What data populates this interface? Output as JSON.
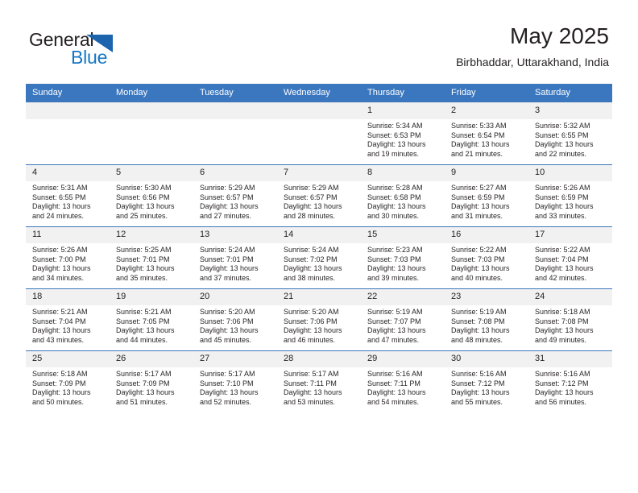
{
  "logo": {
    "word1": "General",
    "word2": "Blue",
    "triangle_color": "#1c64ae",
    "blue_text_color": "#1476c6"
  },
  "header": {
    "title": "May 2025",
    "subtitle": "Birbhaddar, Uttarakhand, India"
  },
  "theme": {
    "accent": "#3b77bf",
    "daynum_bg": "#f1f1f1",
    "text": "#231f20"
  },
  "calendar": {
    "weekday_headers": [
      "Sunday",
      "Monday",
      "Tuesday",
      "Wednesday",
      "Thursday",
      "Friday",
      "Saturday"
    ],
    "weeks": [
      [
        {
          "day": "",
          "lines": []
        },
        {
          "day": "",
          "lines": []
        },
        {
          "day": "",
          "lines": []
        },
        {
          "day": "",
          "lines": []
        },
        {
          "day": "1",
          "lines": [
            "Sunrise: 5:34 AM",
            "Sunset: 6:53 PM",
            "Daylight: 13 hours and 19 minutes."
          ]
        },
        {
          "day": "2",
          "lines": [
            "Sunrise: 5:33 AM",
            "Sunset: 6:54 PM",
            "Daylight: 13 hours and 21 minutes."
          ]
        },
        {
          "day": "3",
          "lines": [
            "Sunrise: 5:32 AM",
            "Sunset: 6:55 PM",
            "Daylight: 13 hours and 22 minutes."
          ]
        }
      ],
      [
        {
          "day": "4",
          "lines": [
            "Sunrise: 5:31 AM",
            "Sunset: 6:55 PM",
            "Daylight: 13 hours and 24 minutes."
          ]
        },
        {
          "day": "5",
          "lines": [
            "Sunrise: 5:30 AM",
            "Sunset: 6:56 PM",
            "Daylight: 13 hours and 25 minutes."
          ]
        },
        {
          "day": "6",
          "lines": [
            "Sunrise: 5:29 AM",
            "Sunset: 6:57 PM",
            "Daylight: 13 hours and 27 minutes."
          ]
        },
        {
          "day": "7",
          "lines": [
            "Sunrise: 5:29 AM",
            "Sunset: 6:57 PM",
            "Daylight: 13 hours and 28 minutes."
          ]
        },
        {
          "day": "8",
          "lines": [
            "Sunrise: 5:28 AM",
            "Sunset: 6:58 PM",
            "Daylight: 13 hours and 30 minutes."
          ]
        },
        {
          "day": "9",
          "lines": [
            "Sunrise: 5:27 AM",
            "Sunset: 6:59 PM",
            "Daylight: 13 hours and 31 minutes."
          ]
        },
        {
          "day": "10",
          "lines": [
            "Sunrise: 5:26 AM",
            "Sunset: 6:59 PM",
            "Daylight: 13 hours and 33 minutes."
          ]
        }
      ],
      [
        {
          "day": "11",
          "lines": [
            "Sunrise: 5:26 AM",
            "Sunset: 7:00 PM",
            "Daylight: 13 hours and 34 minutes."
          ]
        },
        {
          "day": "12",
          "lines": [
            "Sunrise: 5:25 AM",
            "Sunset: 7:01 PM",
            "Daylight: 13 hours and 35 minutes."
          ]
        },
        {
          "day": "13",
          "lines": [
            "Sunrise: 5:24 AM",
            "Sunset: 7:01 PM",
            "Daylight: 13 hours and 37 minutes."
          ]
        },
        {
          "day": "14",
          "lines": [
            "Sunrise: 5:24 AM",
            "Sunset: 7:02 PM",
            "Daylight: 13 hours and 38 minutes."
          ]
        },
        {
          "day": "15",
          "lines": [
            "Sunrise: 5:23 AM",
            "Sunset: 7:03 PM",
            "Daylight: 13 hours and 39 minutes."
          ]
        },
        {
          "day": "16",
          "lines": [
            "Sunrise: 5:22 AM",
            "Sunset: 7:03 PM",
            "Daylight: 13 hours and 40 minutes."
          ]
        },
        {
          "day": "17",
          "lines": [
            "Sunrise: 5:22 AM",
            "Sunset: 7:04 PM",
            "Daylight: 13 hours and 42 minutes."
          ]
        }
      ],
      [
        {
          "day": "18",
          "lines": [
            "Sunrise: 5:21 AM",
            "Sunset: 7:04 PM",
            "Daylight: 13 hours and 43 minutes."
          ]
        },
        {
          "day": "19",
          "lines": [
            "Sunrise: 5:21 AM",
            "Sunset: 7:05 PM",
            "Daylight: 13 hours and 44 minutes."
          ]
        },
        {
          "day": "20",
          "lines": [
            "Sunrise: 5:20 AM",
            "Sunset: 7:06 PM",
            "Daylight: 13 hours and 45 minutes."
          ]
        },
        {
          "day": "21",
          "lines": [
            "Sunrise: 5:20 AM",
            "Sunset: 7:06 PM",
            "Daylight: 13 hours and 46 minutes."
          ]
        },
        {
          "day": "22",
          "lines": [
            "Sunrise: 5:19 AM",
            "Sunset: 7:07 PM",
            "Daylight: 13 hours and 47 minutes."
          ]
        },
        {
          "day": "23",
          "lines": [
            "Sunrise: 5:19 AM",
            "Sunset: 7:08 PM",
            "Daylight: 13 hours and 48 minutes."
          ]
        },
        {
          "day": "24",
          "lines": [
            "Sunrise: 5:18 AM",
            "Sunset: 7:08 PM",
            "Daylight: 13 hours and 49 minutes."
          ]
        }
      ],
      [
        {
          "day": "25",
          "lines": [
            "Sunrise: 5:18 AM",
            "Sunset: 7:09 PM",
            "Daylight: 13 hours and 50 minutes."
          ]
        },
        {
          "day": "26",
          "lines": [
            "Sunrise: 5:17 AM",
            "Sunset: 7:09 PM",
            "Daylight: 13 hours and 51 minutes."
          ]
        },
        {
          "day": "27",
          "lines": [
            "Sunrise: 5:17 AM",
            "Sunset: 7:10 PM",
            "Daylight: 13 hours and 52 minutes."
          ]
        },
        {
          "day": "28",
          "lines": [
            "Sunrise: 5:17 AM",
            "Sunset: 7:11 PM",
            "Daylight: 13 hours and 53 minutes."
          ]
        },
        {
          "day": "29",
          "lines": [
            "Sunrise: 5:16 AM",
            "Sunset: 7:11 PM",
            "Daylight: 13 hours and 54 minutes."
          ]
        },
        {
          "day": "30",
          "lines": [
            "Sunrise: 5:16 AM",
            "Sunset: 7:12 PM",
            "Daylight: 13 hours and 55 minutes."
          ]
        },
        {
          "day": "31",
          "lines": [
            "Sunrise: 5:16 AM",
            "Sunset: 7:12 PM",
            "Daylight: 13 hours and 56 minutes."
          ]
        }
      ]
    ]
  }
}
